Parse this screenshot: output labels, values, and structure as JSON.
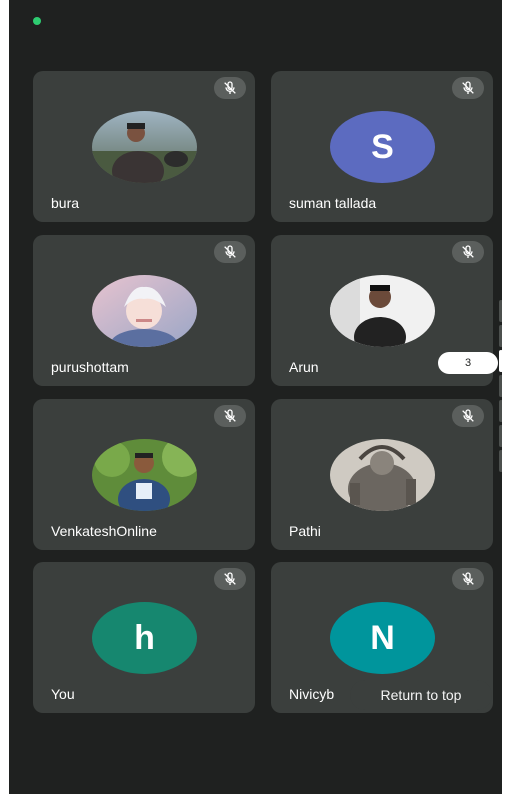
{
  "colors": {
    "background": "#1f2120",
    "tile": "#3b3f3d",
    "accent_dot": "#2ecc71"
  },
  "participants": [
    {
      "name": "bura",
      "avatar_type": "photo",
      "mic": "muted-mic-icon"
    },
    {
      "name": "suman tallada",
      "avatar_type": "initial",
      "initial": "S",
      "avatar_color": "#5c6bc0",
      "mic": "muted-mic-icon"
    },
    {
      "name": "purushottam",
      "avatar_type": "photo",
      "mic": "muted-mic-icon"
    },
    {
      "name": "Arun",
      "avatar_type": "photo",
      "mic": "muted-mic-icon"
    },
    {
      "name": "VenkateshOnline",
      "avatar_type": "photo",
      "mic": "muted-mic-icon"
    },
    {
      "name": "Pathi",
      "avatar_type": "photo",
      "mic": "muted-mic-icon"
    },
    {
      "name": "You",
      "avatar_type": "initial",
      "initial": "h",
      "avatar_color": "#16876f",
      "mic": "muted-mic-icon"
    },
    {
      "name": "Nivicyb",
      "avatar_type": "initial",
      "initial": "N",
      "avatar_color": "#00959c",
      "mic": "muted-mic-icon"
    }
  ],
  "page_indicator": "3",
  "return_to_top_label": "Return to top"
}
